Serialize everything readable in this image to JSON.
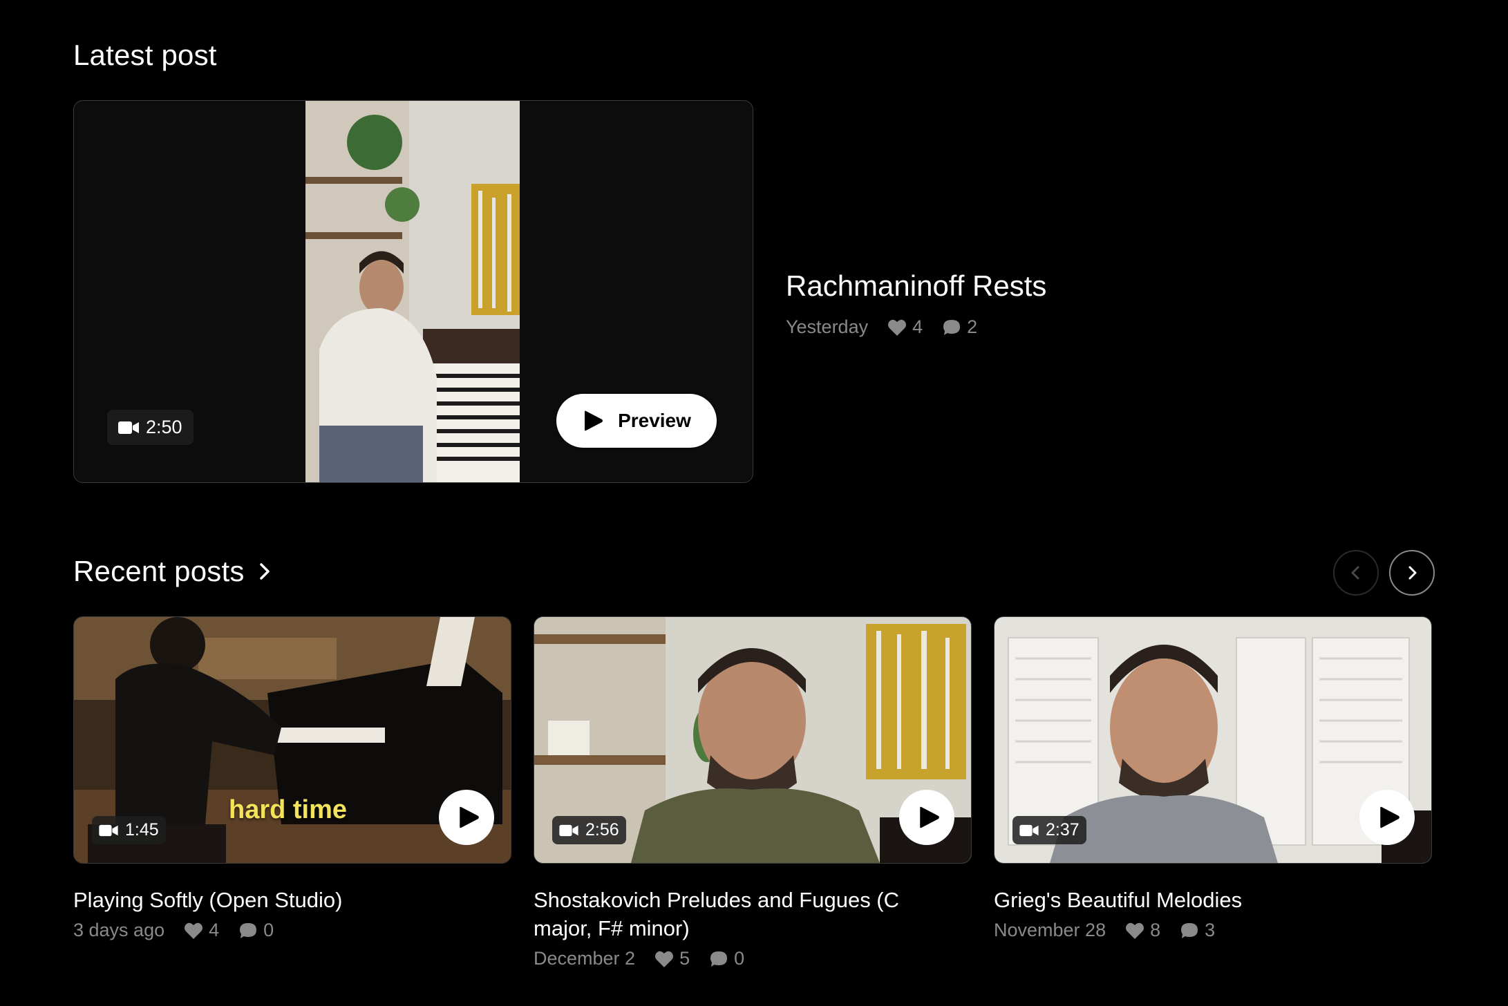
{
  "latest": {
    "section_title": "Latest post",
    "post": {
      "title": "Rachmaninoff Rests",
      "date": "Yesterday",
      "likes": "4",
      "comments": "2",
      "duration": "2:50",
      "preview_label": "Preview"
    }
  },
  "recent": {
    "section_title": "Recent posts",
    "posts": [
      {
        "title": "Playing Softly (Open Studio)",
        "date": "3 days ago",
        "likes": "4",
        "comments": "0",
        "duration": "1:45",
        "overlay_caption": "hard time"
      },
      {
        "title": "Shostakovich Preludes and Fugues (C major, F# minor)",
        "date": "December 2",
        "likes": "5",
        "comments": "0",
        "duration": "2:56"
      },
      {
        "title": "Grieg's Beautiful Melodies",
        "date": "November 28",
        "likes": "8",
        "comments": "3",
        "duration": "2:37"
      }
    ]
  },
  "icons": {
    "video": "video-camera-icon",
    "like": "heart-icon",
    "comment": "comment-bubble-icon",
    "play": "play-icon",
    "chevron_right": "chevron-right-icon",
    "chevron_left": "chevron-left-icon"
  },
  "colors": {
    "background": "#000000",
    "text_primary": "#ffffff",
    "text_muted": "#8a8a8a",
    "caption_yellow": "#f2e35a"
  }
}
